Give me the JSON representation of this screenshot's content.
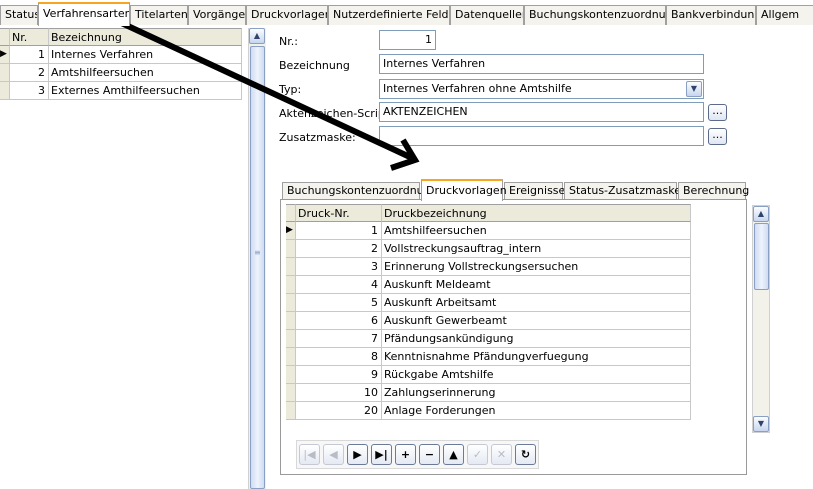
{
  "top_tabs": [
    {
      "label": "Status"
    },
    {
      "label": "Verfahrensarten",
      "active": true
    },
    {
      "label": "Titelarten"
    },
    {
      "label": "Vorgänge"
    },
    {
      "label": "Druckvorlagen"
    },
    {
      "label": "Nutzerdefinierte Felder"
    },
    {
      "label": "Datenquellen"
    },
    {
      "label": "Buchungskontenzuordnung"
    },
    {
      "label": "Bankverbindung"
    },
    {
      "label": "Allgem"
    }
  ],
  "left_grid": {
    "headers": {
      "nr": "Nr.",
      "bezeichnung": "Bezeichnung"
    },
    "rows": [
      {
        "nr": "1",
        "bezeichnung": "Internes Verfahren"
      },
      {
        "nr": "2",
        "bezeichnung": "Amtshilfeersuchen"
      },
      {
        "nr": "3",
        "bezeichnung": "Externes Amthilfeersuchen"
      }
    ],
    "current_row_marker": "▶"
  },
  "form": {
    "nr": {
      "label": "Nr.:",
      "value": "1"
    },
    "bezeichnung": {
      "label": "Bezeichnung",
      "value": "Internes Verfahren"
    },
    "typ": {
      "label": "Typ:",
      "value": "Internes Verfahren ohne Amtshilfe"
    },
    "aktenzeichen": {
      "label": "Aktenzeichen-Script:",
      "value": "AKTENZEICHEN"
    },
    "zusatzmaske": {
      "label": "Zusatzmaske:",
      "value": ""
    },
    "ellipsis": "..."
  },
  "inner_tabs": [
    {
      "label": "Buchungskontenzuordnung"
    },
    {
      "label": "Druckvorlagen",
      "active": true
    },
    {
      "label": "Ereignisse"
    },
    {
      "label": "Status-Zusatzmasken"
    },
    {
      "label": "Berechnung"
    }
  ],
  "print_grid": {
    "headers": {
      "nr": "Druck-Nr.",
      "bezeichnung": "Druckbezeichnung"
    },
    "rows": [
      {
        "nr": "1",
        "bezeichnung": "Amtshilfeersuchen"
      },
      {
        "nr": "2",
        "bezeichnung": "Vollstreckungsauftrag_intern"
      },
      {
        "nr": "3",
        "bezeichnung": "Erinnerung Vollstreckungsersuchen"
      },
      {
        "nr": "4",
        "bezeichnung": "Auskunft Meldeamt"
      },
      {
        "nr": "5",
        "bezeichnung": "Auskunft Arbeitsamt"
      },
      {
        "nr": "6",
        "bezeichnung": "Auskunft Gewerbeamt"
      },
      {
        "nr": "7",
        "bezeichnung": "Pfändungsankündigung"
      },
      {
        "nr": "8",
        "bezeichnung": "Kenntnisnahme Pfändungverfuegung"
      },
      {
        "nr": "9",
        "bezeichnung": "Rückgabe Amtshilfe"
      },
      {
        "nr": "10",
        "bezeichnung": "Zahlungserinnerung"
      },
      {
        "nr": "20",
        "bezeichnung": "Anlage Forderungen"
      }
    ],
    "current_row_marker": "▶"
  },
  "navigator": [
    {
      "name": "nav-first-button",
      "glyph": "|◀",
      "enabled": false
    },
    {
      "name": "nav-prior-button",
      "glyph": "◀",
      "enabled": false
    },
    {
      "name": "nav-next-button",
      "glyph": "▶",
      "enabled": true
    },
    {
      "name": "nav-last-button",
      "glyph": "▶|",
      "enabled": true
    },
    {
      "name": "nav-insert-button",
      "glyph": "+",
      "enabled": true
    },
    {
      "name": "nav-delete-button",
      "glyph": "−",
      "enabled": true
    },
    {
      "name": "nav-edit-button",
      "glyph": "▲",
      "enabled": true
    },
    {
      "name": "nav-post-button",
      "glyph": "✓",
      "enabled": false
    },
    {
      "name": "nav-cancel-button",
      "glyph": "✕",
      "enabled": false
    },
    {
      "name": "nav-refresh-button",
      "glyph": "↻",
      "enabled": true
    }
  ],
  "colors": {
    "active_tab_accent": "#f5a623",
    "arrow": "#000000",
    "grid_header": "#ebeadb"
  }
}
